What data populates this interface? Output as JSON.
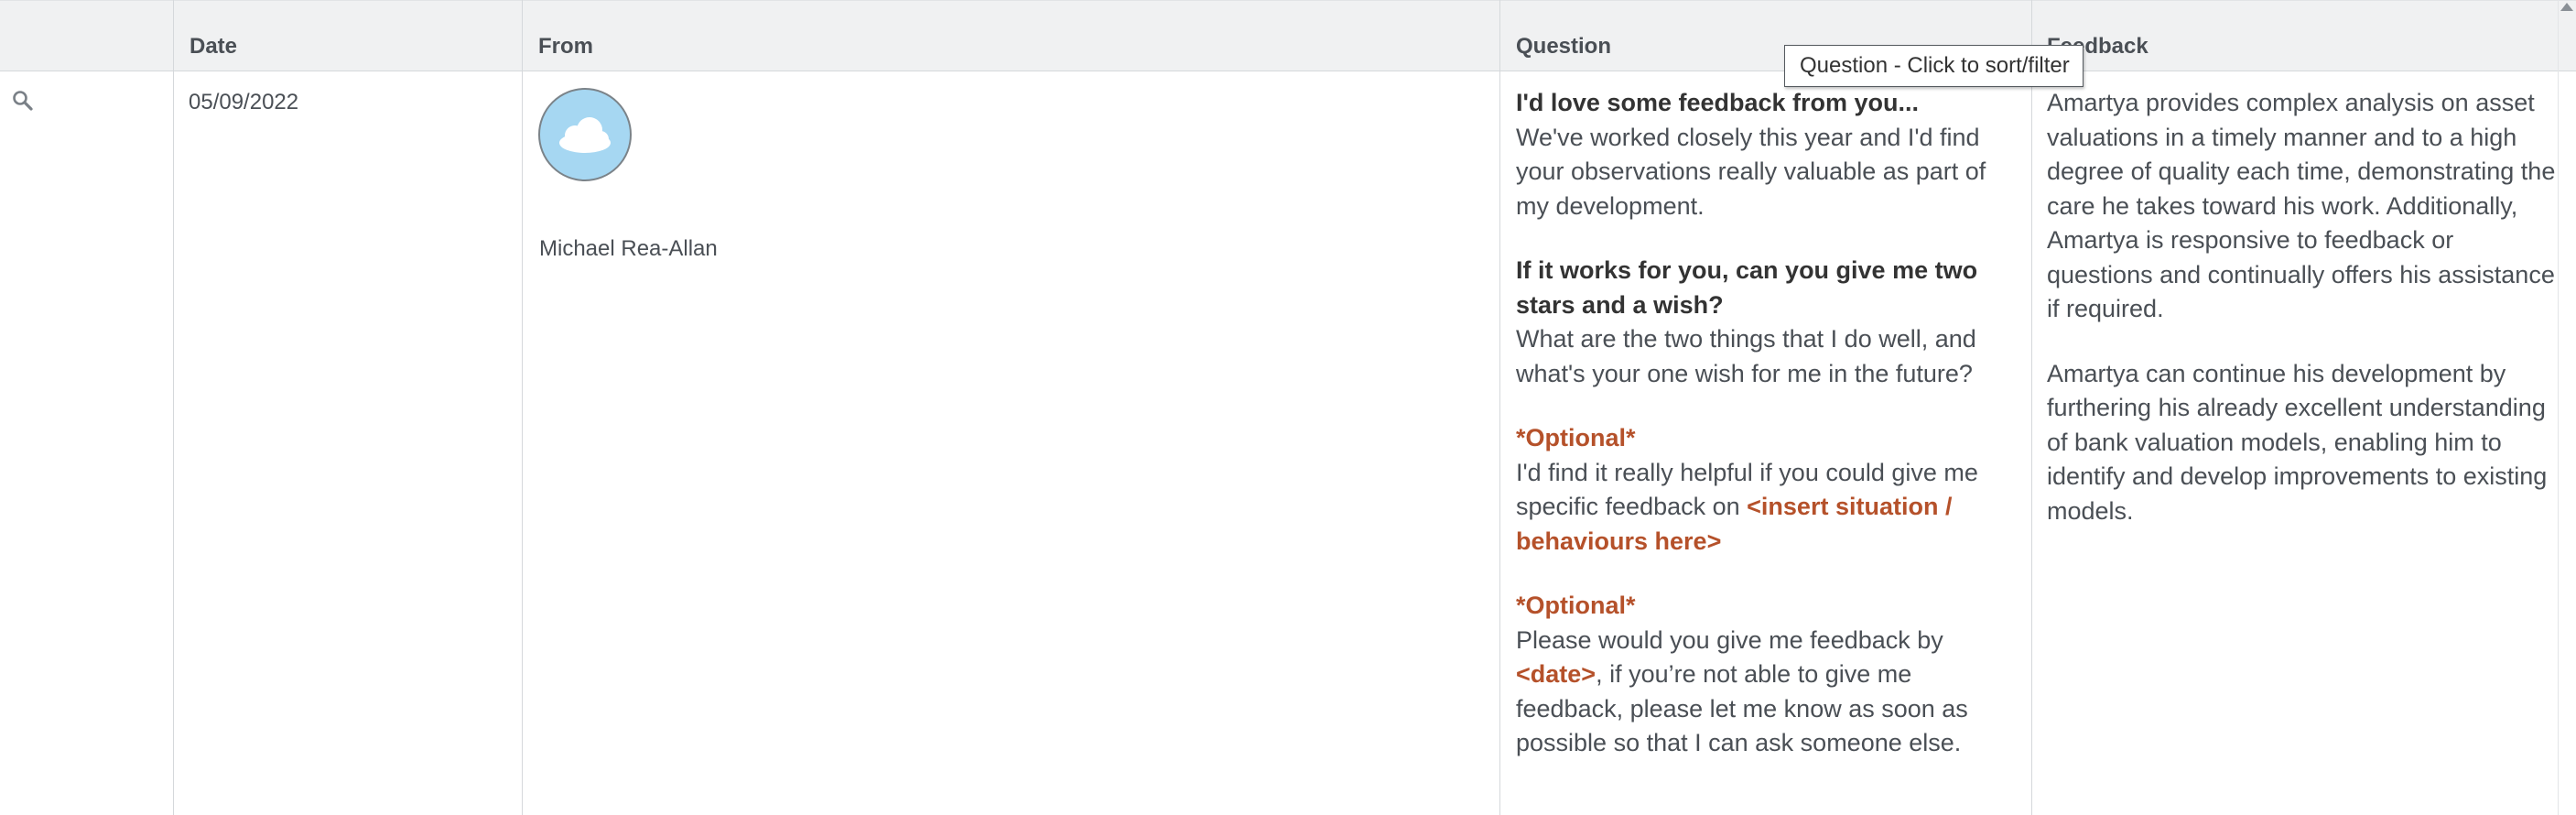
{
  "header": {
    "col_date": "Date",
    "col_from": "From",
    "col_question": "Question",
    "col_feedback": "Feedback"
  },
  "tooltip": {
    "text": "Question - Click to sort/filter"
  },
  "row": {
    "date": "05/09/2022",
    "from_name": "Michael Rea-Allan",
    "question": {
      "p1_title": "I'd love some feedback from you...",
      "p1_body": "We've worked closely this year and I'd find your observations really valuable as part of my development.",
      "p2_title": "If it works for you, can you give me two stars and a wish?",
      "p2_body": "What are the two things that I do well, and what's your one wish for me in the future?",
      "p3_title": "*Optional*",
      "p3_body_a": "I'd find it really helpful if you could give me specific feedback on ",
      "p3_body_b": "<insert situation / behaviours here>",
      "p4_title": "*Optional*",
      "p4_body_a": "Please would you give me feedback by ",
      "p4_body_b": "<date>",
      "p4_body_c": ", if you’re not able to give me feedback, please let me know as soon as possible so that I can ask someone else."
    },
    "feedback": {
      "p1": "Amartya provides complex analysis on asset valuations in a timely manner and to a high degree of quality each time, demonstrating the care he takes toward his work. Additionally, Amartya is responsive to feedback or questions and continually offers his assistance if required.",
      "p2": "Amartya can continue his development by furthering his already excellent understanding of bank valuation models, enabling him to identify and develop improvements to existing models."
    }
  },
  "icons": {
    "row_action": "search-icon",
    "avatar": "cloud-avatar-icon"
  },
  "colors": {
    "accent": "#b5512a",
    "header_bg": "#f0f1f2",
    "avatar_bg": "#a6d7f2"
  }
}
